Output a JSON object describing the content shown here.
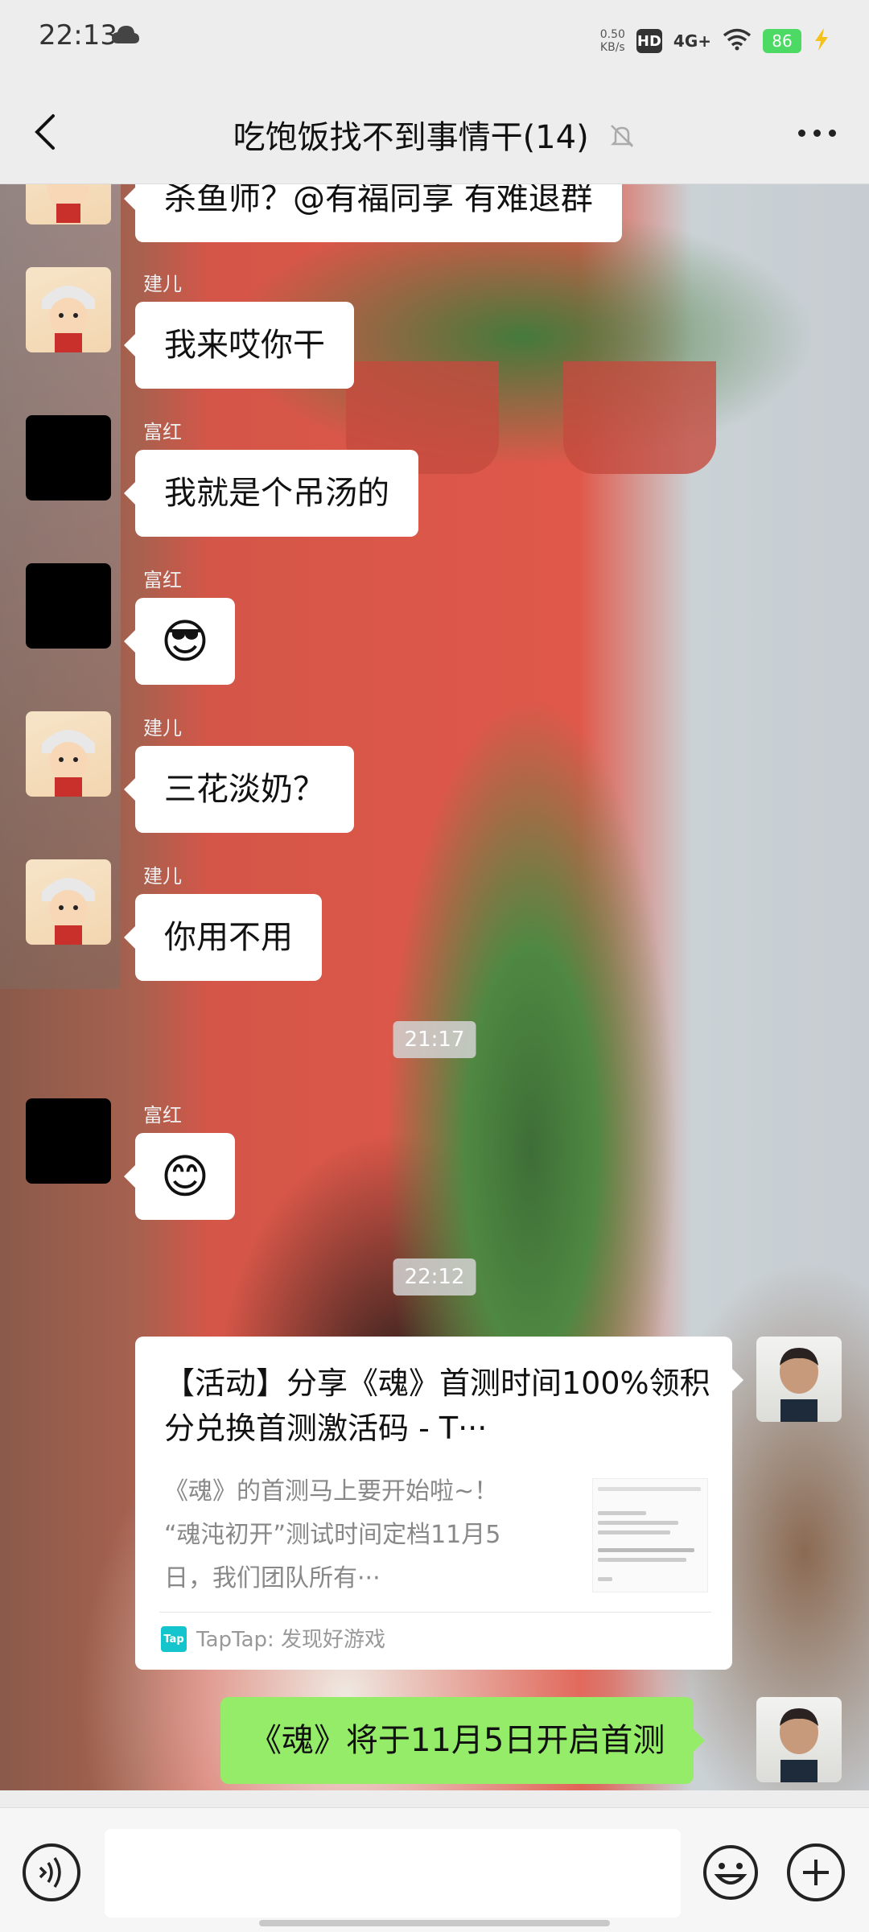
{
  "status_bar": {
    "time": "22:13",
    "net_speed_value": "0.50",
    "net_speed_unit": "KB/s",
    "hd_label": "HD",
    "network": "4G+",
    "battery": "86"
  },
  "header": {
    "title": "吃饱饭找不到事情干(14)"
  },
  "messages": [
    {
      "sender": "",
      "text": "杀鱼师？@有福同享 有难退群"
    },
    {
      "sender": "建儿",
      "text": "我来哎你干"
    },
    {
      "sender": "富红",
      "text": "我就是个吊汤的"
    },
    {
      "sender": "富红",
      "text": "😎"
    },
    {
      "sender": "建儿",
      "text": "三花淡奶？"
    },
    {
      "sender": "建儿",
      "text": "你用不用"
    },
    {
      "time": "21:17"
    },
    {
      "sender": "富红",
      "text": "😊"
    },
    {
      "time": "22:12"
    }
  ],
  "share_card": {
    "title": "【活动】分享《魂》首测时间100%领积分兑换首测激活码 - T···",
    "description": "《魂》的首测马上要开始啦~！ “魂沌初开”测试时间定档11月5日，我们团队所有···",
    "source_icon": "Tap",
    "source": "TapTap: 发现好游戏"
  },
  "own_message": {
    "text": "《魂》将于11月5日开启首测"
  },
  "input": {
    "placeholder": ""
  },
  "colors": {
    "own_bubble": "#95ec69",
    "page_bg": "#ededed",
    "share_icon": "#15c5ce"
  }
}
